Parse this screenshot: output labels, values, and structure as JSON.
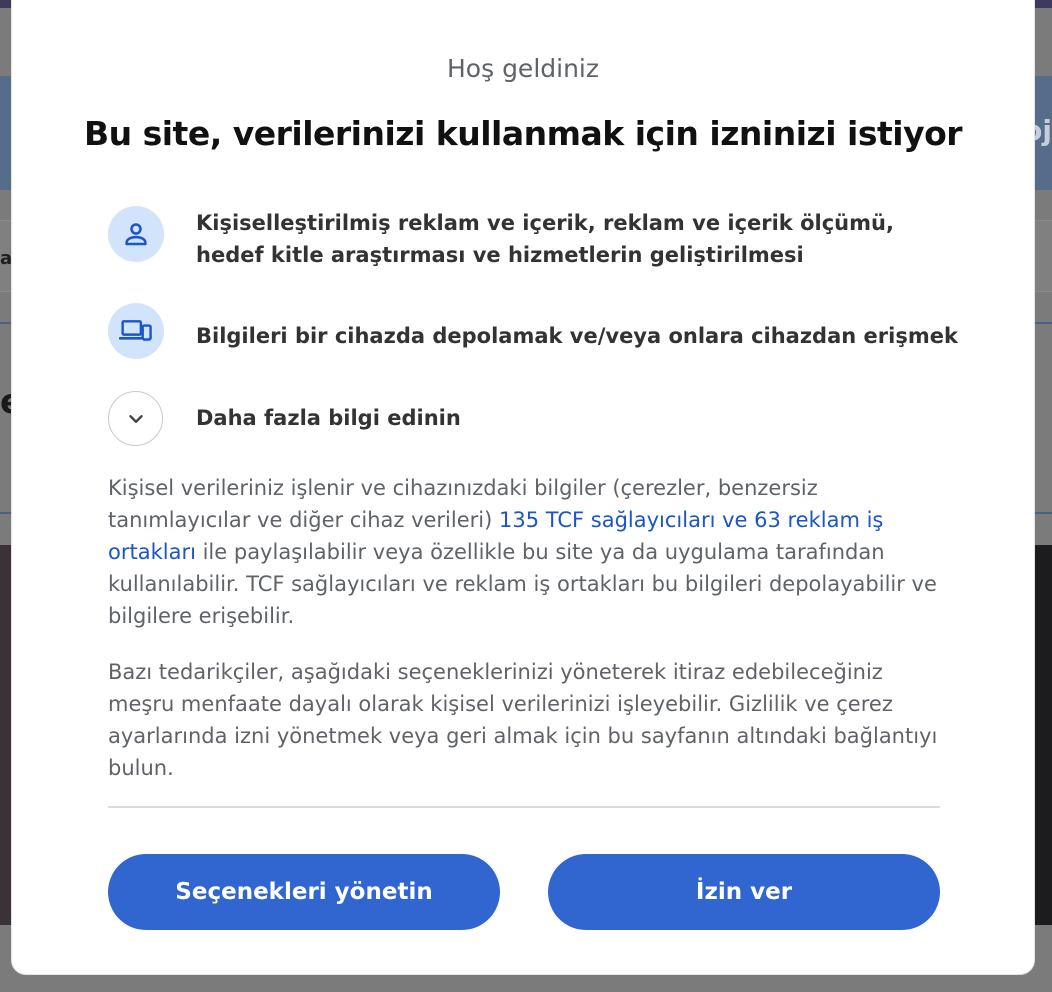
{
  "dialog": {
    "welcome": "Hoş geldiniz",
    "title": "Bu site, verilerinizi kullanmak için izninizi istiyor",
    "purposes": [
      {
        "icon": "person-icon",
        "label": "Kişiselleştirilmiş reklam ve içerik, reklam ve içerik ölçümü, hedef kitle araştırması ve hizmetlerin geliştirilmesi"
      },
      {
        "icon": "devices-icon",
        "label": "Bilgileri bir cihazda depolamak ve/veya onlara cihazdan erişmek"
      },
      {
        "icon": "chevron-down-icon",
        "label": "Daha fazla bilgi edinin"
      }
    ],
    "paragraph1": {
      "before": "Kişisel verileriniz işlenir ve cihazınızdaki bilgiler (çerezler, benzersiz tanımlayıcılar ve diğer cihaz verileri) ",
      "link": "135 TCF sağlayıcıları ve 63 reklam iş ortakları",
      "after": " ile paylaşılabilir veya özellikle bu site ya da uygulama tarafından kullanılabilir. TCF sağlayıcıları ve reklam iş ortakları bu bilgileri depolayabilir ve bilgilere erişebilir."
    },
    "paragraph2": "Bazı tedarikçiler, aşağıdaki seçeneklerinizi yöneterek itiraz edebileceğiniz meşru menfaate dayalı olarak kişisel verilerinizi işleyebilir. Gizlilik ve çerez ayarlarında izni yönetmek veya geri almak için bu sayfanın altındaki bağlantıyı bulun.",
    "buttons": {
      "manage": "Seçenekleri yönetin",
      "consent": "İzin ver"
    }
  },
  "colors": {
    "accent": "#3166d0",
    "link": "#1a55c9",
    "icon_bg": "#d2e3fc",
    "icon_fg": "#1a55c9",
    "overlay": "#7b7b7b"
  }
}
